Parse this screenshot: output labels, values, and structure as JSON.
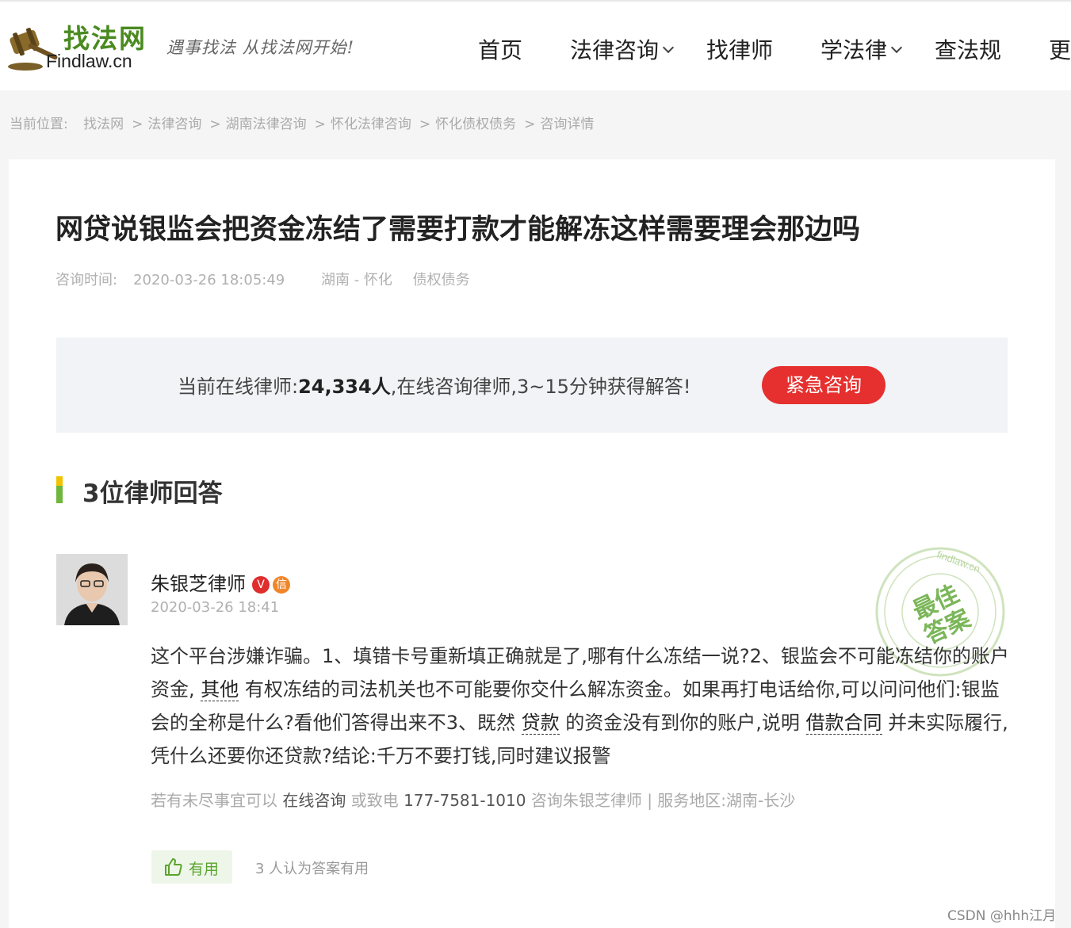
{
  "header": {
    "logo_cn": "找法网",
    "logo_en": "Findlaw.cn",
    "slogan": "遇事找法 从找法网开始!"
  },
  "nav": {
    "items": [
      {
        "label": "首页",
        "has_dropdown": false
      },
      {
        "label": "法律咨询",
        "has_dropdown": true
      },
      {
        "label": "找律师",
        "has_dropdown": false
      },
      {
        "label": "学法律",
        "has_dropdown": true
      },
      {
        "label": "查法规",
        "has_dropdown": false
      },
      {
        "label": "更",
        "has_dropdown": false
      }
    ]
  },
  "breadcrumb": {
    "prefix": "当前位置:",
    "items": [
      "找法网",
      "法律咨询",
      "湖南法律咨询",
      "怀化法律咨询",
      "怀化债权债务",
      "咨询详情"
    ],
    "separator": ">"
  },
  "question": {
    "title": "网贷说银监会把资金冻结了需要打款才能解冻这样需要理会那边吗",
    "time_label": "咨询时间:",
    "time": "2020-03-26 18:05:49",
    "location": "湖南 - 怀化",
    "category": "债权债务"
  },
  "banner": {
    "text_before": "当前在线律师:",
    "count": "24,334人",
    "text_after": ",在线咨询律师,3~15分钟获得解答!",
    "button_label": "紧急咨询"
  },
  "answers": {
    "heading": "3位律师回答",
    "items": [
      {
        "lawyer_name": "朱银芝律师",
        "badge_v": "V",
        "badge_xin": "信",
        "time": "2020-03-26 18:41",
        "stamp_top": "最佳",
        "stamp_bottom": "答案",
        "stamp_ring": "findlaw.cn",
        "body_parts": [
          "这个平台涉嫌诈骗。1、填错卡号重新填正确就是了,哪有什么冻结一说?2、银监会不可能冻结你的账户资金, ",
          "其他",
          " 有权冻结的司法机关也不可能要你交什么解冻资金。如果再打电话给你,可以问问他们:银监会的全称是什么?看他们答得出来不3、既然 ",
          "贷款",
          " 的资金没有到你的账户,说明 ",
          "借款合同",
          " 并未实际履行,凭什么还要你还贷款?结论:千万不要打钱,同时建议报警"
        ],
        "foot_prefix": "若有未尽事宜可以 ",
        "foot_online": "在线咨询",
        "foot_mid": " 或致电 ",
        "foot_phone": "177-7581-1010",
        "foot_consult": " 咨询朱银芝律师 | 服务地区:",
        "foot_region": "湖南-长沙",
        "useful_label": "有用",
        "useful_count": "3 人认为答案有用"
      }
    ]
  },
  "watermark": "CSDN @hhh江月",
  "colors": {
    "brand_green": "#4a8a1f",
    "urgent_red": "#e5302f",
    "accent_yellow": "#f2c200",
    "accent_green": "#6fb63c"
  }
}
